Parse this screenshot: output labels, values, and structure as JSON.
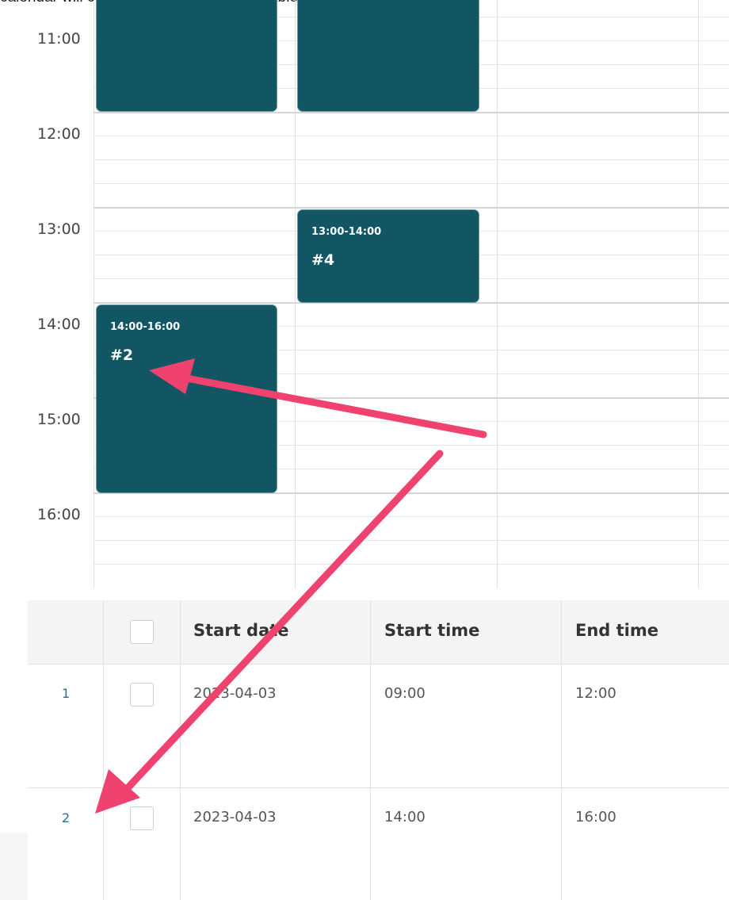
{
  "caption": "calendar will correspond to a row in the table below.",
  "calendar": {
    "hours": [
      "11:00",
      "12:00",
      "13:00",
      "14:00",
      "15:00",
      "16:00"
    ],
    "events": [
      {
        "time": "",
        "title": ""
      },
      {
        "time": "",
        "title": ""
      },
      {
        "time": "13:00-14:00",
        "title": "#4"
      },
      {
        "time": "14:00-16:00",
        "title": "#2"
      }
    ],
    "event_color": "#125663"
  },
  "table": {
    "headers": [
      "Start date",
      "Start time",
      "End time"
    ],
    "rows": [
      {
        "num": "1",
        "start_date": "2023-04-03",
        "start_time": "09:00",
        "end_time": "12:00"
      },
      {
        "num": "2",
        "start_date": "2023-04-03",
        "start_time": "14:00",
        "end_time": "16:00"
      }
    ]
  },
  "annotations": {
    "arrow_color": "#f0426e"
  }
}
